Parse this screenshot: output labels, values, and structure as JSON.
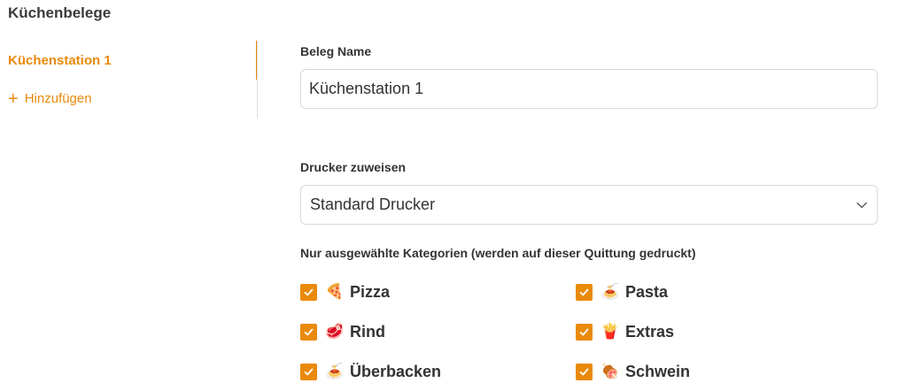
{
  "page": {
    "title": "Küchenbelege"
  },
  "sidebar": {
    "items": [
      {
        "label": "Küchenstation 1"
      }
    ],
    "add_label": "Hinzufügen"
  },
  "form": {
    "name_label": "Beleg Name",
    "name_value": "Küchenstation 1",
    "printer_label": "Drucker zuweisen",
    "printer_value": "Standard Drucker",
    "categories_label": "Nur ausgewählte Kategorien (werden auf dieser Quittung gedruckt)",
    "categories": [
      {
        "icon": "pizza-icon",
        "emoji": "🍕",
        "label": "Pizza",
        "checked": true
      },
      {
        "icon": "pasta-icon",
        "emoji": "🍝",
        "label": "Pasta",
        "checked": true
      },
      {
        "icon": "meat-icon",
        "emoji": "🥩",
        "label": "Rind",
        "checked": true
      },
      {
        "icon": "fries-icon",
        "emoji": "🍟",
        "label": "Extras",
        "checked": true
      },
      {
        "icon": "casserole-icon",
        "emoji": "🍝",
        "label": "Überbacken",
        "checked": true
      },
      {
        "icon": "drumstick-icon",
        "emoji": "🍖",
        "label": "Schwein",
        "checked": true
      }
    ]
  },
  "colors": {
    "accent": "#e98a0b",
    "border": "#d9d9d9",
    "text": "#333333"
  }
}
